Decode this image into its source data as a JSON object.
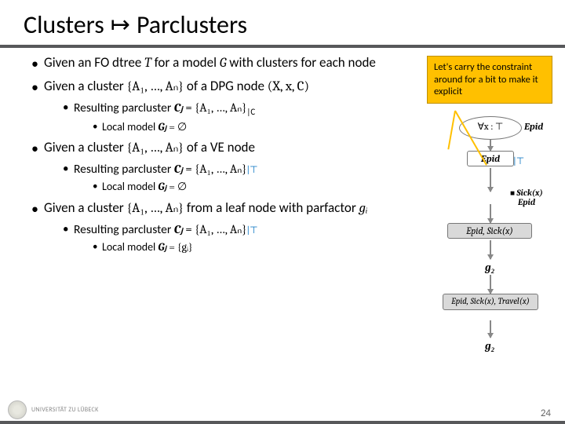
{
  "title": {
    "left": "Clusters",
    "right": "Parclusters"
  },
  "bullets": {
    "b1_pre": "Given an FO dtree ",
    "b1_T": "T",
    "b1_mid": " for a model ",
    "b1_G": "G",
    "b1_post": " with clusters for each node",
    "b2_pre": "Given a cluster ",
    "b2_set": "{A₁, …, Aₙ}",
    "b2_mid": " of a DPG node ",
    "b2_tuple": "(X, x, C)",
    "b2a_pre": "Resulting parcluster ",
    "b2a_cj": "Cⱼ",
    "b2a_eq": " = {A₁, …, Aₙ}",
    "b2a_sub": "|C",
    "b2b": "Local model ",
    "b2b_gj": "Gⱼ",
    "b2b_eq": " = ∅",
    "b3_pre": "Given a cluster ",
    "b3_set": "{A₁, …, Aₙ}",
    "b3_post": " of a VE node",
    "b3a_pre": "Resulting parcluster ",
    "b3a_cj": "Cⱼ",
    "b3a_eq": " = {A₁, …, Aₙ}",
    "b3a_sub": "|⊤",
    "b3b": "Local model ",
    "b3b_gj": "Gⱼ",
    "b3b_eq": " = ∅",
    "b4_pre": "Given a cluster ",
    "b4_set": "{A₁, …, Aₙ}",
    "b4_mid": " from a leaf node with parfactor ",
    "b4_gi": "gᵢ",
    "b4a_pre": "Resulting parcluster ",
    "b4a_cj": "Cⱼ",
    "b4a_eq": " = {A₁, …, Aₙ}",
    "b4a_sub": "|⊤",
    "b4b": "Local model ",
    "b4b_gj": "Gⱼ",
    "b4b_eq": " = {gᵢ}"
  },
  "callout": "Let's carry the constraint around for a bit to make it explicit",
  "diagram": {
    "root": "∀x : ⊤",
    "root_side": "Epid",
    "n1": "Epid",
    "n1_sub": "|⊤",
    "n2_top": "Sick(x)",
    "n2_bot": "Epid",
    "n2_side": "",
    "n3": "Epid, Sick(x)",
    "g2a": "g₂",
    "n4": "Epid, Sick(x), Travel(x)",
    "g2b": "g₂"
  },
  "footer": {
    "page": "24",
    "institution": "UNIVERSITÄT ZU LÜBECK"
  }
}
